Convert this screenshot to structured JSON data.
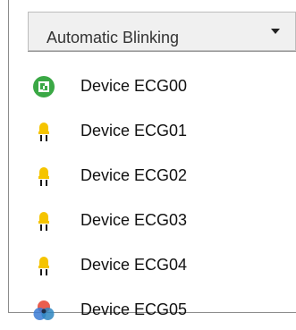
{
  "dropdown": {
    "selected": "Automatic Blinking"
  },
  "devices": [
    {
      "label": "Device ECG00",
      "icon": "green-device-icon"
    },
    {
      "label": "Device ECG01",
      "icon": "yellow-light-icon"
    },
    {
      "label": "Device ECG02",
      "icon": "yellow-light-icon"
    },
    {
      "label": "Device ECG03",
      "icon": "yellow-light-icon"
    },
    {
      "label": "Device ECG04",
      "icon": "yellow-light-icon"
    },
    {
      "label": "Device ECG05",
      "icon": "rgb-color-icon"
    }
  ],
  "colors": {
    "green": "#3aa845",
    "yellow": "#f5c400",
    "red": "#e74c3c",
    "blue": "#3a7bd5"
  }
}
